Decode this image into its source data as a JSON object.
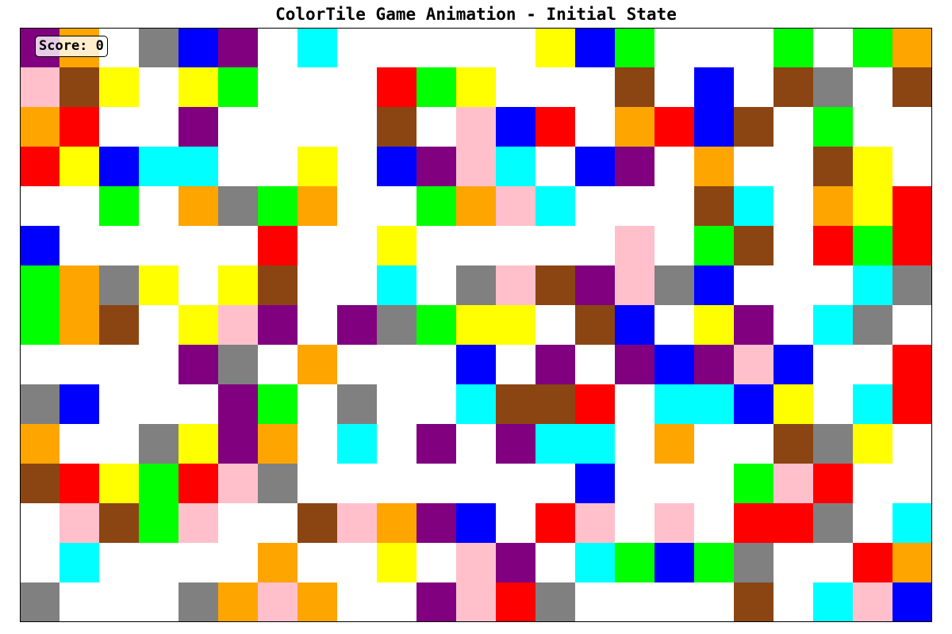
{
  "title": "ColorTile Game Animation - Initial State",
  "score_text": "Score: 0",
  "board": {
    "cols": 23,
    "rows": 15,
    "palette": {
      "W": "#ffffff",
      "R": "#ff0000",
      "G": "#00ff00",
      "B": "#0000ff",
      "Y": "#ffff00",
      "C": "#00ffff",
      "P": "#800080",
      "O": "#ffa500",
      "K": "#ffc0cb",
      "N": "#8b4513",
      "A": "#808080"
    },
    "color_names": {
      "W": "empty",
      "R": "red",
      "G": "green",
      "B": "blue",
      "Y": "yellow",
      "C": "cyan",
      "P": "purple",
      "O": "orange",
      "K": "pink",
      "N": "brown",
      "A": "gray"
    },
    "tiles": [
      "POWABPWCWWWWWYBGWWWGWGO",
      "KNYWYGWWWRGYWWWNWBWNAWN",
      "ORWWPWWWWNWKBRWORBNWGWW",
      "RYBCCWWYWBPKCWBPWOWWNYW",
      "WWGWOAGOWWGOKCWWWNCWOYR",
      "BWWWWWRWWYWWWWWKWGNWRGR",
      "GOAYWYNWWCWAKNPKABWWWCA",
      "GONWYKPWPAGYYWNBWYPWCAW",
      "WWWWPAWOWWWBWPWPBPKBWWR",
      "ABWWWPGWAWWCNNRWCCBYWCR",
      "OWWAYPOWCWPWPCCWOWWNAYW",
      "NRYGRKAWWWWWWWBWWWGKRWW",
      "WKNGKWWNKOPBWRKWKWRRAWC",
      "WCWWWWOWWYWKPWCGBGAWWRO",
      "AWWWAOKOWWPKRAWWWWNWCKB"
    ]
  }
}
